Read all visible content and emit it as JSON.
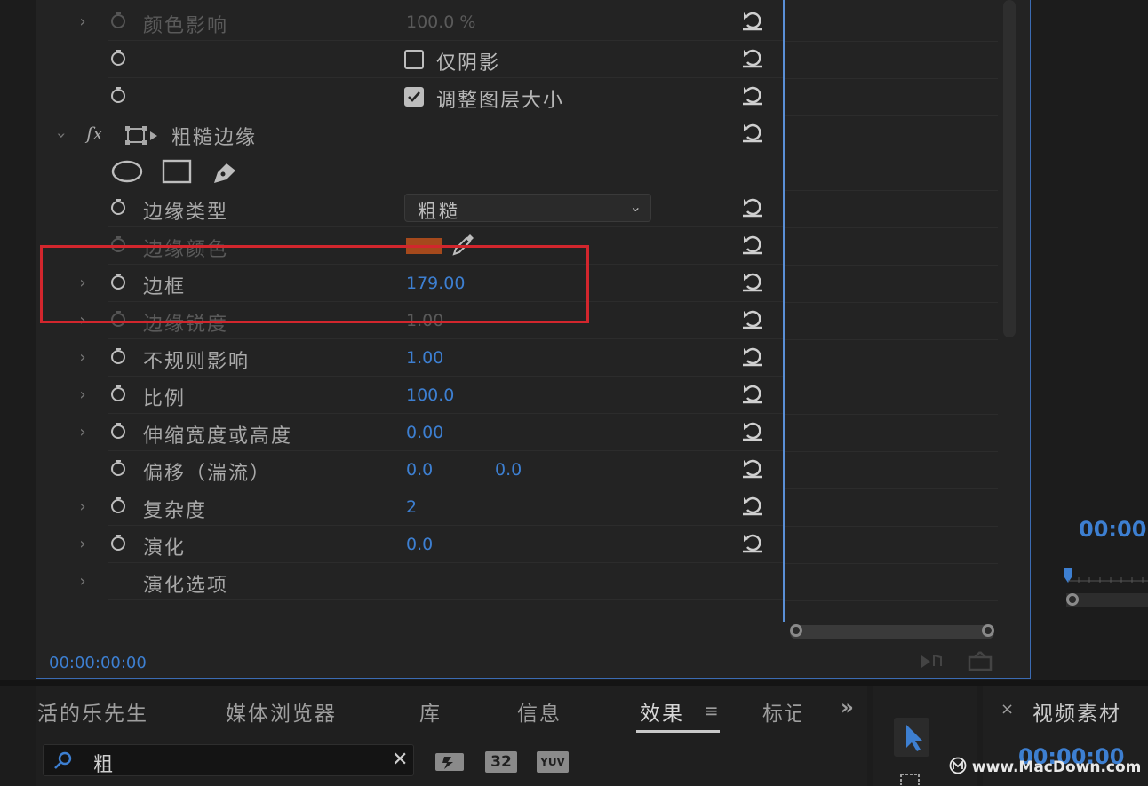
{
  "effect_controls": {
    "rows": [
      {
        "label": "颜色影响",
        "value": "100.0 %",
        "expandable": true,
        "dim": true
      },
      {
        "checkbox_label": "仅阴影",
        "checked": false
      },
      {
        "checkbox_label": "调整图层大小",
        "checked": true
      },
      {
        "effect_title": "粗糙边缘",
        "fx_label": "fx"
      },
      {
        "shape_tools": [
          "ellipse-mask-icon",
          "rectangle-mask-icon",
          "pen-mask-icon"
        ]
      },
      {
        "label": "边缘类型",
        "dropdown_value": "粗糙",
        "dropdown_arrow": "⌄"
      },
      {
        "label": "边缘颜色",
        "color": "#c5521a",
        "dim": true
      },
      {
        "label": "边框",
        "value": "179.00",
        "expandable": true
      },
      {
        "label": "边缘锐度",
        "value": "1.00",
        "expandable": true,
        "dim": true
      },
      {
        "label": "不规则影响",
        "value": "1.00",
        "expandable": true
      },
      {
        "label": "比例",
        "value": "100.0",
        "expandable": true
      },
      {
        "label": "伸缩宽度或高度",
        "value": "0.00",
        "expandable": true
      },
      {
        "label": "偏移（湍流）",
        "value": "0.0",
        "value2": "0.0"
      },
      {
        "label": "复杂度",
        "value": "2",
        "expandable": true
      },
      {
        "label": "演化",
        "value": "0.0",
        "expandable": true
      },
      {
        "label": "演化选项",
        "expandable": true
      }
    ],
    "footer_time": "00:00:00:00",
    "highlight_color": "#d2262d"
  },
  "program_monitor": {
    "timecode": "00:00:"
  },
  "bottom_tabs": {
    "items": [
      "活的乐先生",
      "媒体浏览器",
      "库",
      "信息",
      "效果",
      "标记"
    ],
    "active": "效果",
    "menu_icon": "≡",
    "overflow": "»"
  },
  "effects_search": {
    "value": "粗",
    "clear": "✕",
    "filters": [
      "accelerated-effects-icon",
      "32-bit-icon",
      "yuv-icon"
    ],
    "filter_labels": [
      "",
      "32",
      "YUV"
    ]
  },
  "source_panel": {
    "close": "×",
    "title": "视频素材",
    "timecode": "00:00:00"
  },
  "watermark": "www.MacDown.com",
  "colors": {
    "accent_blue": "#3d7fd1",
    "panel_bg": "#232323",
    "border_blue": "#3b6bb3"
  }
}
